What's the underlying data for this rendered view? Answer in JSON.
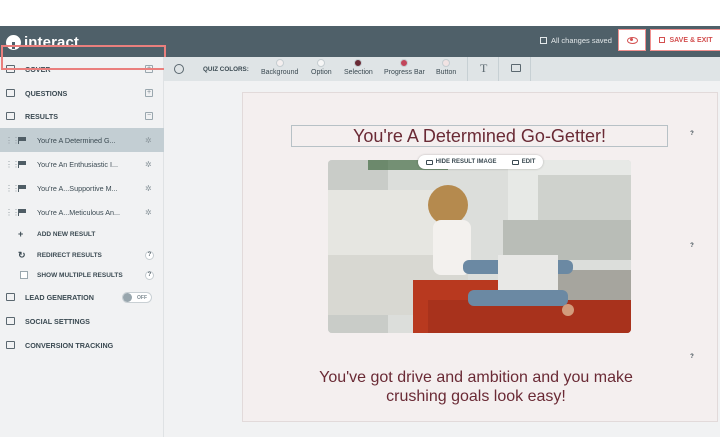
{
  "app": {
    "logo_text": "interact",
    "saved_status": "All changes saved",
    "save_exit_label": "SAVE & EXIT"
  },
  "sidebar": {
    "sections": [
      {
        "label": "COVER"
      },
      {
        "label": "QUESTIONS"
      },
      {
        "label": "RESULTS"
      }
    ],
    "results": [
      {
        "label": "You're A Determined G..."
      },
      {
        "label": "You're An Enthusiastic I..."
      },
      {
        "label": "You're A...Supportive M..."
      },
      {
        "label": "You're A...Meticulous An..."
      }
    ],
    "add_new_result": "ADD NEW RESULT",
    "redirect_results": "REDIRECT RESULTS",
    "show_multiple_results": "SHOW MULTIPLE RESULTS",
    "lead_generation": "LEAD GENERATION",
    "lead_toggle": "OFF",
    "social_settings": "SOCIAL SETTINGS",
    "conversion_tracking": "CONVERSION TRACKING",
    "help_mark": "?"
  },
  "toolbar": {
    "quiz_colors_label": "QUIZ COLORS:",
    "swatches": [
      {
        "label": "Background",
        "color": "#f4efef"
      },
      {
        "label": "Option",
        "color": "#f6f6f6"
      },
      {
        "label": "Selection",
        "color": "#6a2a35"
      },
      {
        "label": "Progress Bar",
        "color": "#c2455a"
      },
      {
        "label": "Button",
        "color": "#f1e3e3"
      }
    ],
    "text_tool": "T"
  },
  "result": {
    "title": "You're A Determined Go-Getter!",
    "hide_image_label": "HIDE RESULT IMAGE",
    "edit_label": "EDIT",
    "description": "You've got drive and ambition and you make crushing goals look easy!",
    "help_mark": "?"
  },
  "colors": {
    "topbar": "#4f6069",
    "accent": "#d34f4f",
    "title_text": "#6a2a35"
  }
}
